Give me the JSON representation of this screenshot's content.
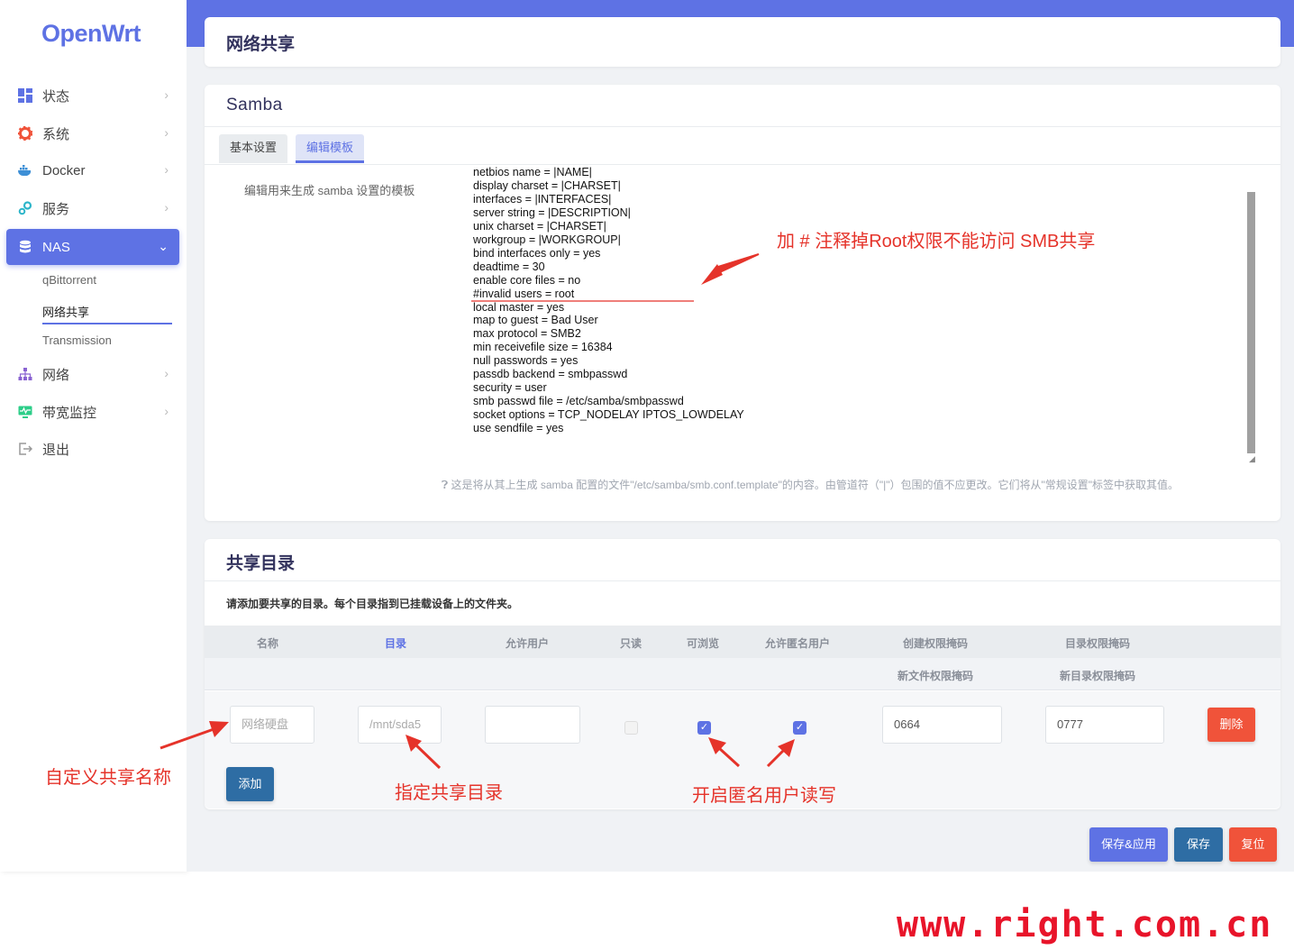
{
  "sidebar": {
    "logo": "OpenWrt",
    "items": [
      {
        "label": "状态"
      },
      {
        "label": "系统"
      },
      {
        "label": "Docker"
      },
      {
        "label": "服务"
      },
      {
        "label": "NAS"
      },
      {
        "label": "网络"
      },
      {
        "label": "带宽监控"
      },
      {
        "label": "退出"
      }
    ],
    "sub_items": [
      {
        "label": "qBittorrent"
      },
      {
        "label": "网络共享"
      },
      {
        "label": "Transmission"
      }
    ]
  },
  "page": {
    "title": "网络共享"
  },
  "samba": {
    "title": "Samba",
    "tabs": [
      {
        "label": "基本设置"
      },
      {
        "label": "编辑模板"
      }
    ],
    "field_label": "编辑用来生成 samba 设置的模板",
    "template_lines": [
      "netbios name = |NAME|",
      "display charset = |CHARSET|",
      "interfaces = |INTERFACES|",
      "server string = |DESCRIPTION|",
      "unix charset = |CHARSET|",
      "workgroup = |WORKGROUP|",
      "bind interfaces only = yes",
      "deadtime = 30",
      "enable core files = no",
      "#invalid users = root",
      "local master = yes",
      "map to guest = Bad User",
      "max protocol = SMB2",
      "min receivefile size = 16384",
      "null passwords = yes",
      "passdb backend = smbpasswd",
      "security = user",
      "smb passwd file = /etc/samba/smbpasswd",
      "socket options = TCP_NODELAY IPTOS_LOWDELAY",
      "use sendfile = yes"
    ],
    "hint": "这是将从其上生成 samba 配置的文件\"/etc/samba/smb.conf.template\"的内容。由管道符（\"|\"）包围的值不应更改。它们将从\"常规设置\"标签中获取其值。"
  },
  "shares": {
    "title": "共享目录",
    "description": "请添加要共享的目录。每个目录指到已挂载设备上的文件夹。",
    "columns": {
      "name": "名称",
      "path": "目录",
      "users": "允许用户",
      "readonly": "只读",
      "browseable": "可浏览",
      "guest": "允许匿名用户",
      "create_mask": "创建权限掩码",
      "dir_mask": "目录权限掩码"
    },
    "subcolumns": {
      "create_mask": "新文件权限掩码",
      "dir_mask": "新目录权限掩码"
    },
    "row": {
      "name_placeholder": "网络硬盘",
      "path_placeholder": "/mnt/sda5",
      "users_value": "",
      "readonly": false,
      "browseable": true,
      "guest": true,
      "create_mask": "0664",
      "dir_mask": "0777"
    },
    "delete_label": "删除",
    "add_label": "添加"
  },
  "footer": {
    "save_apply": "保存&应用",
    "save": "保存",
    "reset": "复位"
  },
  "annotations": {
    "comment_note": "加 # 注释掉Root权限不能访问 SMB共享",
    "name_note": "自定义共享名称",
    "path_note": "指定共享目录",
    "guest_note": "开启匿名用户读写"
  },
  "watermark": "www.right.com.cn",
  "colors": {
    "accent": "#5e72e4",
    "danger": "#f0533a",
    "primary": "#2e6da4",
    "annotation": "#e5332a"
  }
}
